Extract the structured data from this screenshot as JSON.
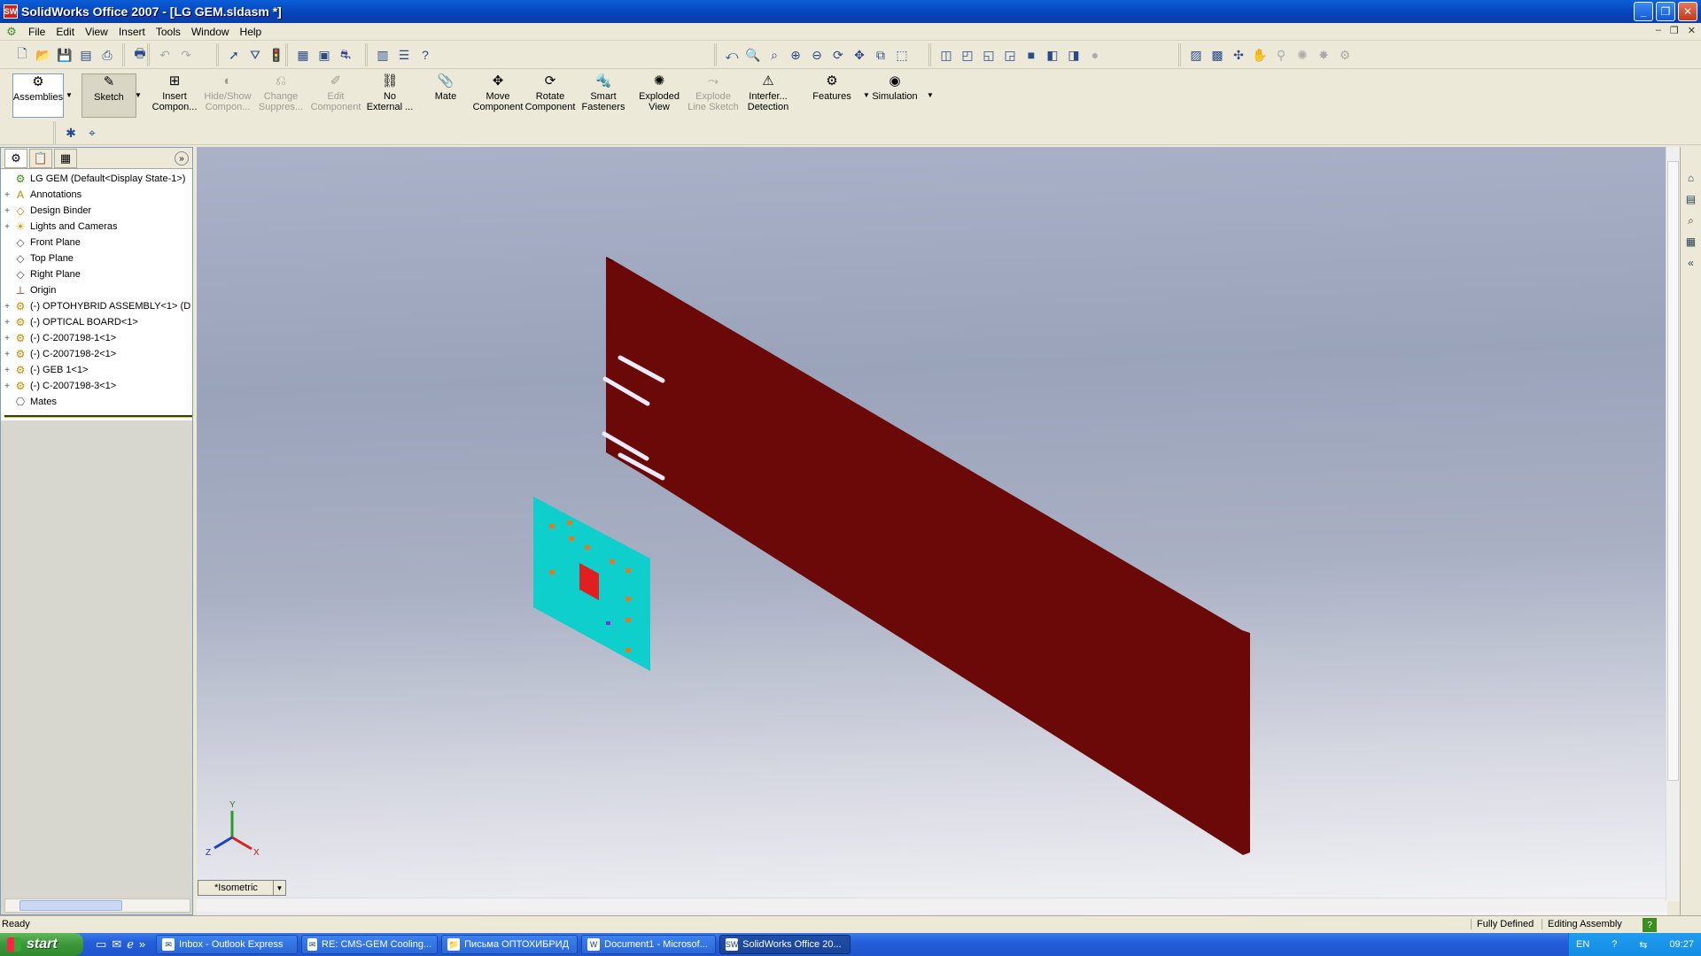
{
  "window": {
    "title": "SolidWorks Office 2007 - [LG GEM.sldasm *]",
    "app_icon": "SW"
  },
  "menu": {
    "items": [
      "File",
      "Edit",
      "View",
      "Insert",
      "Tools",
      "Window",
      "Help"
    ]
  },
  "command_manager": {
    "buttons": [
      {
        "label": "Assemblies",
        "state": "active"
      },
      {
        "label": "Sketch",
        "state": "pressed"
      },
      {
        "label": "Insert\nCompon...",
        "state": "normal"
      },
      {
        "label": "Hide/Show\nCompon...",
        "state": "disabled"
      },
      {
        "label": "Change\nSuppres...",
        "state": "disabled"
      },
      {
        "label": "Edit\nComponent",
        "state": "disabled"
      },
      {
        "label": "No\nExternal ...",
        "state": "normal"
      },
      {
        "label": "Mate",
        "state": "normal"
      },
      {
        "label": "Move\nComponent",
        "state": "normal"
      },
      {
        "label": "Rotate\nComponent",
        "state": "normal"
      },
      {
        "label": "Smart\nFasteners",
        "state": "normal"
      },
      {
        "label": "Exploded\nView",
        "state": "normal"
      },
      {
        "label": "Explode\nLine Sketch",
        "state": "disabled"
      },
      {
        "label": "Interfer...\nDetection",
        "state": "normal"
      },
      {
        "label": "Features",
        "state": "normal"
      },
      {
        "label": "Simulation",
        "state": "normal"
      }
    ]
  },
  "feature_tree": {
    "root": "LG GEM  (Default<Display State-1>)",
    "items": [
      {
        "label": "Annotations",
        "icon": "annotations-icon",
        "expandable": true
      },
      {
        "label": "Design Binder",
        "icon": "design-binder-icon",
        "expandable": true
      },
      {
        "label": "Lights and Cameras",
        "icon": "lights-icon",
        "expandable": true
      },
      {
        "label": "Front Plane",
        "icon": "plane-icon",
        "expandable": false
      },
      {
        "label": "Top Plane",
        "icon": "plane-icon",
        "expandable": false
      },
      {
        "label": "Right Plane",
        "icon": "plane-icon",
        "expandable": false
      },
      {
        "label": "Origin",
        "icon": "origin-icon",
        "expandable": false
      },
      {
        "label": "(-) OPTOHYBRID ASSEMBLY<1> (D",
        "icon": "subassembly-icon",
        "expandable": true
      },
      {
        "label": "(-) OPTICAL BOARD<1>",
        "icon": "part-icon",
        "expandable": true
      },
      {
        "label": "(-) C-2007198-1<1>",
        "icon": "part-icon",
        "expandable": true
      },
      {
        "label": "(-) C-2007198-2<1>",
        "icon": "part-icon",
        "expandable": true
      },
      {
        "label": "(-) GEB 1<1>",
        "icon": "part-icon",
        "expandable": true
      },
      {
        "label": "(-) C-2007198-3<1>",
        "icon": "part-icon",
        "expandable": true
      },
      {
        "label": "Mates",
        "icon": "mates-icon",
        "expandable": false
      }
    ]
  },
  "graphics": {
    "view_orientation": "*Isometric",
    "triad": {
      "x": "X",
      "y": "Y",
      "z": "Z"
    },
    "colors": {
      "board": "#6b0808",
      "optical_board": "#0ecfcc",
      "chip": "#e02020",
      "pads": "#e37a1e",
      "slots": "#d8d8ef"
    }
  },
  "status": {
    "left": "Ready",
    "defined": "Fully Defined",
    "mode": "Editing Assembly",
    "help": "?"
  },
  "taskbar": {
    "start": "start",
    "tasks": [
      {
        "label": "Inbox - Outlook Express",
        "active": false
      },
      {
        "label": "RE: CMS-GEM Cooling...",
        "active": false
      },
      {
        "label": "Письма ОПТОХИБРИД",
        "active": false
      },
      {
        "label": "Document1 - Microsof...",
        "active": false
      },
      {
        "label": "SolidWorks Office 20...",
        "active": true
      }
    ],
    "tray": {
      "lang": "EN",
      "clock": "09:27"
    }
  }
}
